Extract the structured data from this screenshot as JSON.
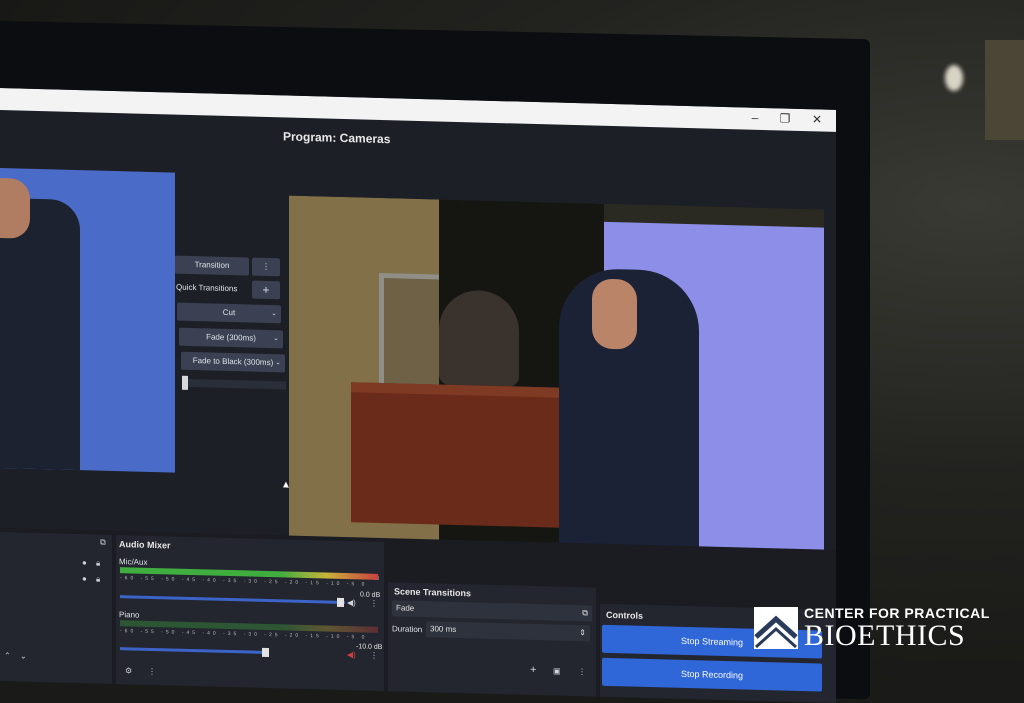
{
  "window": {
    "title": "Program: Cameras",
    "controls": [
      "–",
      "❐",
      "✕"
    ]
  },
  "transitions": {
    "transition_label": "Transition",
    "quick_label": "Quick Transitions",
    "items": [
      "Cut",
      "Fade (300ms)",
      "Fade to Black (300ms)"
    ]
  },
  "audio_mixer": {
    "title": "Audio Mixer",
    "channels": [
      {
        "name": "Mic/Aux",
        "db": "0.0 dB",
        "level": 0.88
      },
      {
        "name": "Piano",
        "db": "-10.0 dB",
        "level": 0.7
      }
    ],
    "ticks": "-60 -55 -50 -45 -40 -35 -30 -25 -20 -15 -10 -5 0"
  },
  "scene_transitions": {
    "title": "Scene Transitions",
    "selected": "Fade",
    "duration_label": "Duration",
    "duration_value": "300 ms"
  },
  "controls": {
    "title": "Controls",
    "stop_streaming": "Stop Streaming",
    "stop_recording": "Stop Recording"
  },
  "logo": {
    "line1": "CENTER FOR PRACTICAL",
    "line2": "BIOETHICS"
  },
  "colors": {
    "accent": "#2f66d8",
    "panel": "#23262e",
    "screen_bg": "#1d1f26"
  }
}
